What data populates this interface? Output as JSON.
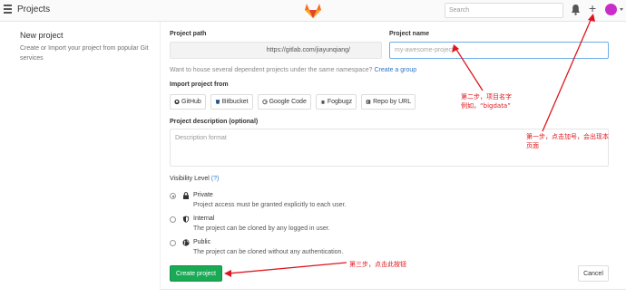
{
  "header": {
    "menu_icon": "hamburger-icon",
    "title": "Projects",
    "logo_icon": "gitlab-tanuki-icon",
    "search_placeholder": "Search",
    "bell_icon": "bell-icon",
    "plus_label": "+",
    "avatar_color": "#c92dc9"
  },
  "left": {
    "title": "New project",
    "description": "Create or Import your project from popular Git services"
  },
  "form": {
    "project_path_label": "Project path",
    "project_path_value": "https://gitlab.com/jiayunqiang/",
    "project_name_label": "Project name",
    "project_name_placeholder": "my-awesome-project",
    "namespace_hint": "Want to house several dependent projects under the same namespace?",
    "namespace_link": "Create a group",
    "import_label": "Import project from",
    "import_buttons": [
      {
        "label": "GitHub",
        "icon": "github-icon"
      },
      {
        "label": "Bitbucket",
        "icon": "bitbucket-icon"
      },
      {
        "label": "Google Code",
        "icon": "google-icon"
      },
      {
        "label": "Fogbugz",
        "icon": "bug-icon"
      },
      {
        "label": "Repo by URL",
        "icon": "git-icon"
      }
    ],
    "description_label": "Project description (optional)",
    "description_placeholder": "Description format",
    "visibility_label": "Visibility Level",
    "visibility_help": "(?)",
    "visibility_options": [
      {
        "name": "Private",
        "icon": "lock-icon",
        "description": "Project access must be granted explicitly to each user.",
        "selected": true
      },
      {
        "name": "Internal",
        "icon": "shield-icon",
        "description": "The project can be cloned by any logged in user.",
        "selected": false
      },
      {
        "name": "Public",
        "icon": "globe-icon",
        "description": "The project can be cloned without any authentication.",
        "selected": false
      }
    ],
    "create_button": "Create project",
    "cancel_button": "Cancel"
  },
  "annotations": {
    "step2_line1": "第二步，项目名字",
    "step2_line2": "例如，“bigdata”",
    "step1_line1": "第一步，点击加号，会出现本",
    "step1_line2": "页面",
    "step3": "第三步，点击此按钮",
    "color": "#e0161e"
  }
}
